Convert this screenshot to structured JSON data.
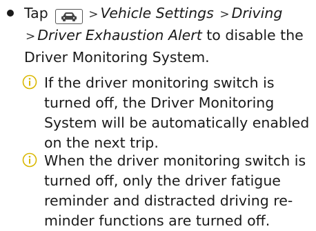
{
  "step": {
    "prefix": "Tap",
    "icon": "car-icon",
    "separator": ">",
    "path1": "Vehicle Settings",
    "path2": "Driving",
    "path3": "Driver Exhaustion Alert",
    "suffix": " to disable the Driver Monitoring System."
  },
  "notes": [
    {
      "icon": "info-icon",
      "text": "If the driver monitoring switch is turned off, the Driver Monitoring System will be automatically enabled on the next trip."
    },
    {
      "icon": "info-icon",
      "text": "When the driver monitoring switch is turned off, only the driver fatigue reminder and distracted driving re-minder functions are turned off."
    }
  ],
  "colors": {
    "text": "#1a1a1a",
    "note_icon": "#d9b700"
  }
}
